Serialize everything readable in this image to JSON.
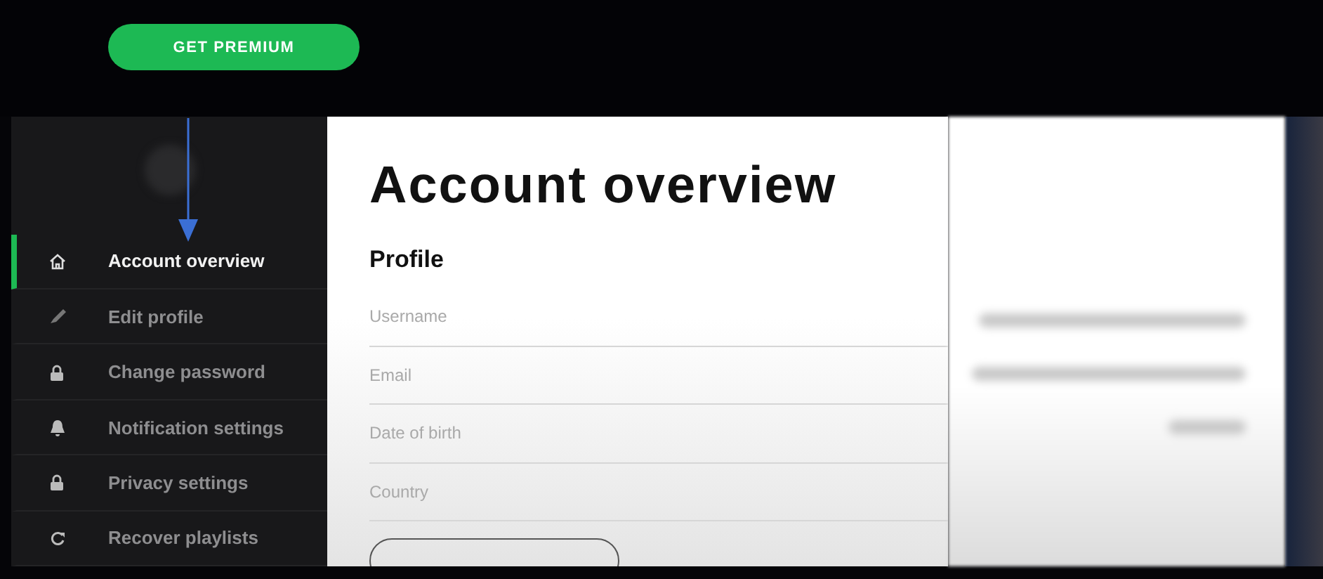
{
  "header": {
    "premium_button": "GET PREMIUM"
  },
  "sidebar": {
    "items": [
      {
        "label": "Account overview",
        "selected": true
      },
      {
        "label": "Edit profile",
        "selected": false
      },
      {
        "label": "Change password",
        "selected": false
      },
      {
        "label": "Notification settings",
        "selected": false
      },
      {
        "label": "Privacy settings",
        "selected": false
      },
      {
        "label": "Recover playlists",
        "selected": false
      }
    ]
  },
  "main": {
    "title": "Account overview",
    "section": "Profile",
    "fields": [
      {
        "label": "Username"
      },
      {
        "label": "Email"
      },
      {
        "label": "Date of birth"
      },
      {
        "label": "Country"
      }
    ]
  }
}
